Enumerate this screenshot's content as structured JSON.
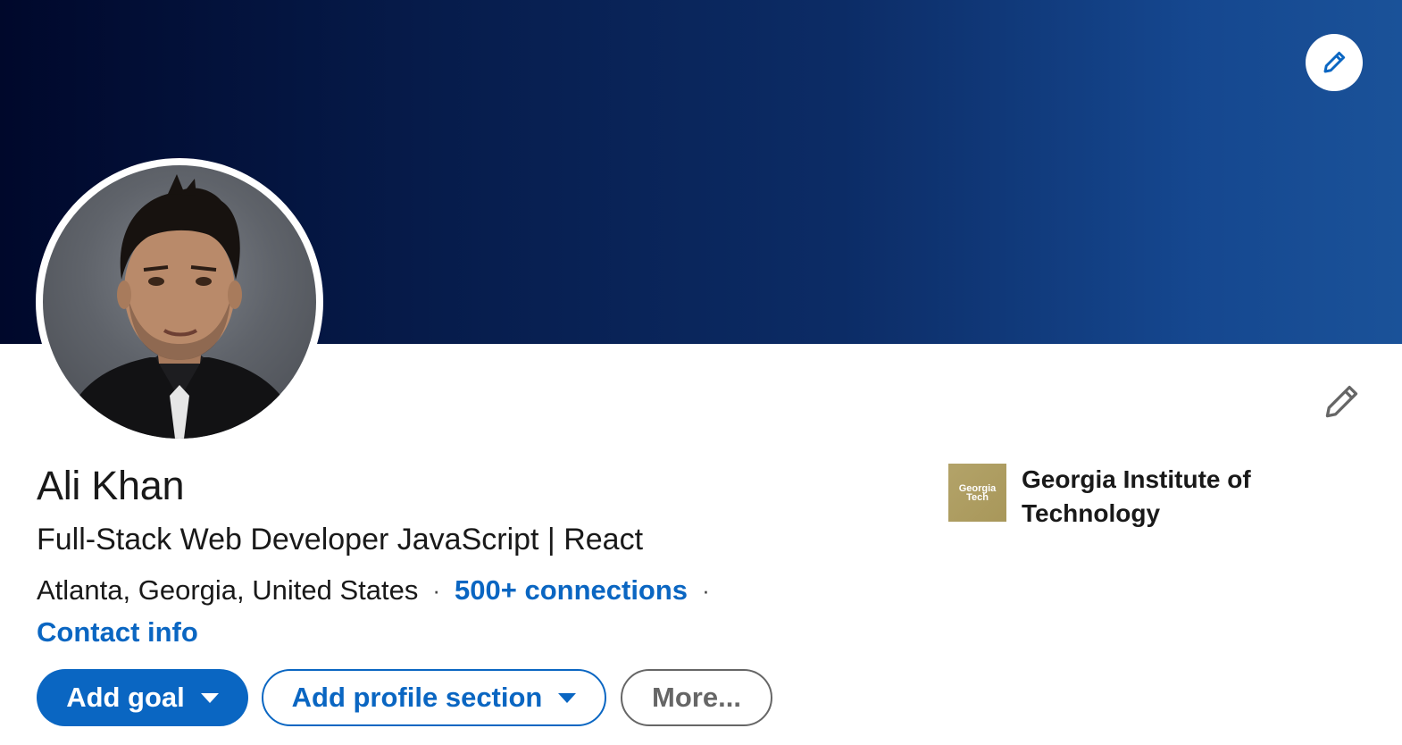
{
  "profile": {
    "name": "Ali Khan",
    "headline": "Full-Stack Web Developer JavaScript | React",
    "location": "Atlanta, Georgia, United States",
    "separator": "·",
    "connections": "500+ connections",
    "contact_info": "Contact info"
  },
  "actions": {
    "add_goal": "Add goal",
    "add_profile_section": "Add profile section",
    "more": "More..."
  },
  "education": {
    "school_name": "Georgia Institute of Technology",
    "logo_text_line1": "Georgia",
    "logo_text_line2": "Tech"
  },
  "icons": {
    "cover_edit": "pencil-icon",
    "intro_edit": "pencil-icon"
  },
  "colors": {
    "link_blue": "#0a66c2",
    "cover_dark": "#00082b",
    "cover_light": "#1a5299",
    "school_gold": "#b3a369"
  }
}
